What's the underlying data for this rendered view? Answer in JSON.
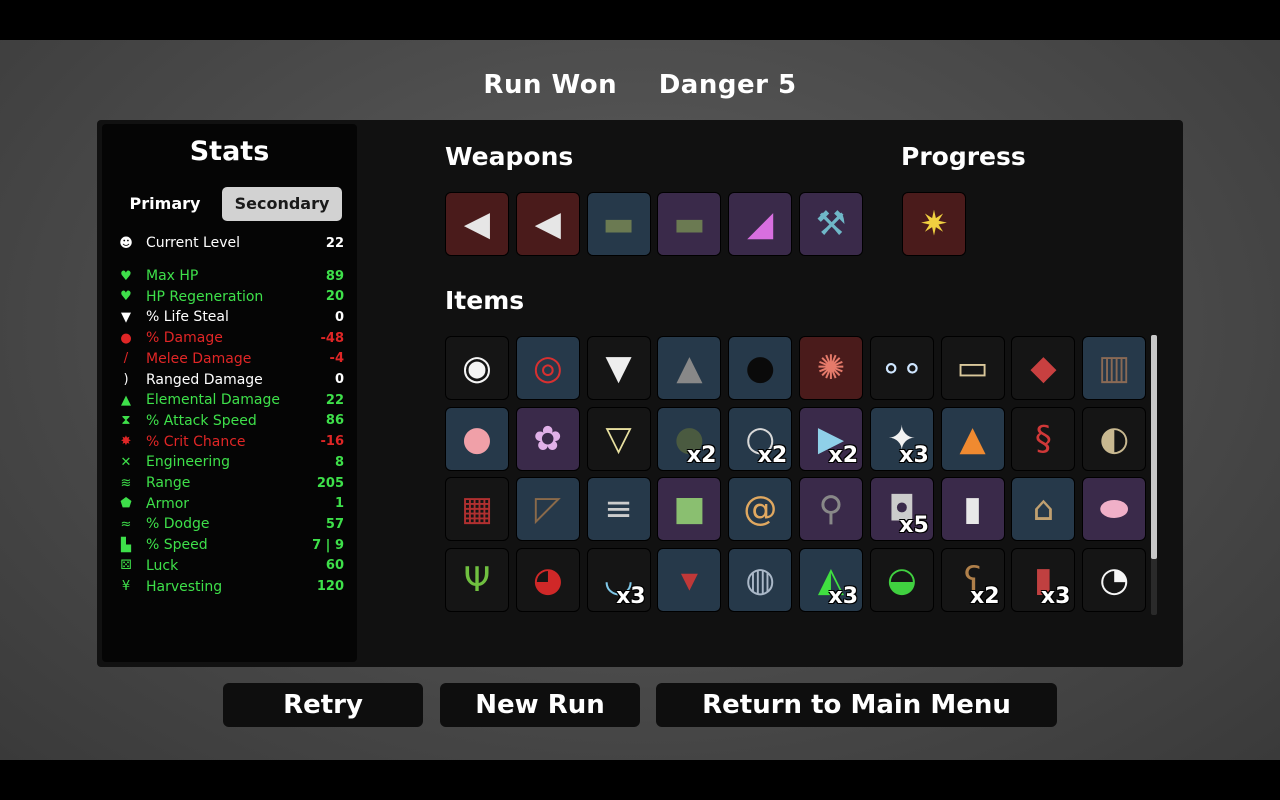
{
  "header": {
    "result": "Run Won",
    "danger": "Danger 5"
  },
  "stats": {
    "title": "Stats",
    "tabs": {
      "primary": "Primary",
      "secondary": "Secondary"
    },
    "level": {
      "label": "Current Level",
      "value": "22"
    },
    "rows": [
      {
        "label": "Max HP",
        "value": "89",
        "color": "#3ee04a",
        "icon": "heart-icon"
      },
      {
        "label": "HP Regeneration",
        "value": "20",
        "color": "#3ee04a",
        "icon": "heart-plus-icon"
      },
      {
        "label": "% Life Steal",
        "value": "0",
        "color": "#ffffff",
        "icon": "fangs-icon"
      },
      {
        "label": "% Damage",
        "value": "-48",
        "color": "#e02626",
        "icon": "muscle-icon"
      },
      {
        "label": "Melee Damage",
        "value": "-4",
        "color": "#e02626",
        "icon": "sword-icon"
      },
      {
        "label": "Ranged Damage",
        "value": "0",
        "color": "#ffffff",
        "icon": "bow-icon"
      },
      {
        "label": "Elemental Damage",
        "value": "22",
        "color": "#3ee04a",
        "icon": "flame-icon"
      },
      {
        "label": "% Attack Speed",
        "value": "86",
        "color": "#3ee04a",
        "icon": "hourglass-icon"
      },
      {
        "label": "% Crit Chance",
        "value": "-16",
        "color": "#e02626",
        "icon": "crit-burst-icon"
      },
      {
        "label": "Engineering",
        "value": "8",
        "color": "#3ee04a",
        "icon": "wrench-icon"
      },
      {
        "label": "Range",
        "value": "205",
        "color": "#3ee04a",
        "icon": "range-waves-icon"
      },
      {
        "label": "Armor",
        "value": "1",
        "color": "#3ee04a",
        "icon": "shield-icon"
      },
      {
        "label": "% Dodge",
        "value": "57",
        "color": "#3ee04a",
        "icon": "dodge-icon"
      },
      {
        "label": "% Speed",
        "value": "7 | 9",
        "color": "#3ee04a",
        "icon": "boot-icon"
      },
      {
        "label": "Luck",
        "value": "60",
        "color": "#3ee04a",
        "icon": "dice-icon"
      },
      {
        "label": "Harvesting",
        "value": "120",
        "color": "#3ee04a",
        "icon": "wheat-icon"
      }
    ]
  },
  "sections": {
    "weapons": "Weapons",
    "progress": "Progress",
    "items": "Items"
  },
  "weapons": [
    {
      "name": "megaphone-weapon-icon",
      "tier": "red"
    },
    {
      "name": "megaphone-weapon-icon",
      "tier": "red"
    },
    {
      "name": "rocket-launcher-weapon-icon",
      "tier": "blue"
    },
    {
      "name": "rocket-launcher-weapon-icon",
      "tier": "purple"
    },
    {
      "name": "hair-dryer-weapon-icon",
      "tier": "purple"
    },
    {
      "name": "hammer-weapon-icon",
      "tier": "purple"
    }
  ],
  "progress": [
    {
      "name": "bullet-explosion-icon",
      "tier": "red"
    }
  ],
  "items": [
    {
      "name": "egg-face-icon",
      "tier": "dark",
      "count": ""
    },
    {
      "name": "red-disc-icon",
      "tier": "blue",
      "count": ""
    },
    {
      "name": "tooth-icon",
      "tier": "dark",
      "count": ""
    },
    {
      "name": "bullet-icon",
      "tier": "blue",
      "count": ""
    },
    {
      "name": "black-spheres-icon",
      "tier": "blue",
      "count": ""
    },
    {
      "name": "octopus-icon",
      "tier": "red",
      "count": ""
    },
    {
      "name": "eyes-icon",
      "tier": "dark",
      "count": ""
    },
    {
      "name": "banknote-icon",
      "tier": "dark",
      "count": ""
    },
    {
      "name": "meat-icon",
      "tier": "dark",
      "count": ""
    },
    {
      "name": "vest-icon",
      "tier": "blue",
      "count": ""
    },
    {
      "name": "piggy-bank-icon",
      "tier": "blue",
      "count": ""
    },
    {
      "name": "brain-icon",
      "tier": "purple",
      "count": ""
    },
    {
      "name": "bucket-icon",
      "tier": "dark",
      "count": ""
    },
    {
      "name": "grenade-icon",
      "tier": "blue",
      "count": "x2"
    },
    {
      "name": "necklace-icon",
      "tier": "blue",
      "count": "x2"
    },
    {
      "name": "triangle-gem-icon",
      "tier": "purple",
      "count": "x2"
    },
    {
      "name": "rabbit-icon",
      "tier": "blue",
      "count": "x3"
    },
    {
      "name": "campfire-icon",
      "tier": "blue",
      "count": ""
    },
    {
      "name": "snake-icon",
      "tier": "dark",
      "count": ""
    },
    {
      "name": "creature-head-icon",
      "tier": "dark",
      "count": ""
    },
    {
      "name": "plaid-shirt-icon",
      "tier": "dark",
      "count": ""
    },
    {
      "name": "wheelbarrow-icon",
      "tier": "blue",
      "count": ""
    },
    {
      "name": "scroll-icon",
      "tier": "blue",
      "count": ""
    },
    {
      "name": "tractor-icon",
      "tier": "purple",
      "count": ""
    },
    {
      "name": "snail-icon",
      "tier": "blue",
      "count": ""
    },
    {
      "name": "chain-tool-icon",
      "tier": "purple",
      "count": ""
    },
    {
      "name": "cup-icon",
      "tier": "purple",
      "count": "x5"
    },
    {
      "name": "bottle-icon",
      "tier": "purple",
      "count": ""
    },
    {
      "name": "garden-icon",
      "tier": "blue",
      "count": ""
    },
    {
      "name": "pink-blob-icon",
      "tier": "purple",
      "count": ""
    },
    {
      "name": "sprout-icon",
      "tier": "dark",
      "count": ""
    },
    {
      "name": "boxing-glove-icon",
      "tier": "dark",
      "count": ""
    },
    {
      "name": "bubbling-pot-icon",
      "tier": "dark",
      "count": "x3"
    },
    {
      "name": "red-cloak-icon",
      "tier": "blue",
      "count": ""
    },
    {
      "name": "potion-flask-icon",
      "tier": "blue",
      "count": ""
    },
    {
      "name": "green-potion-icon",
      "tier": "blue",
      "count": "x3"
    },
    {
      "name": "green-slime-icon",
      "tier": "dark",
      "count": ""
    },
    {
      "name": "teddy-bear-icon",
      "tier": "dark",
      "count": "x2"
    },
    {
      "name": "dynamite-icon",
      "tier": "dark",
      "count": "x3"
    },
    {
      "name": "ghost-icon",
      "tier": "dark",
      "count": ""
    }
  ],
  "buttons": {
    "retry": "Retry",
    "new_run": "New Run",
    "main_menu": "Return to Main Menu"
  }
}
